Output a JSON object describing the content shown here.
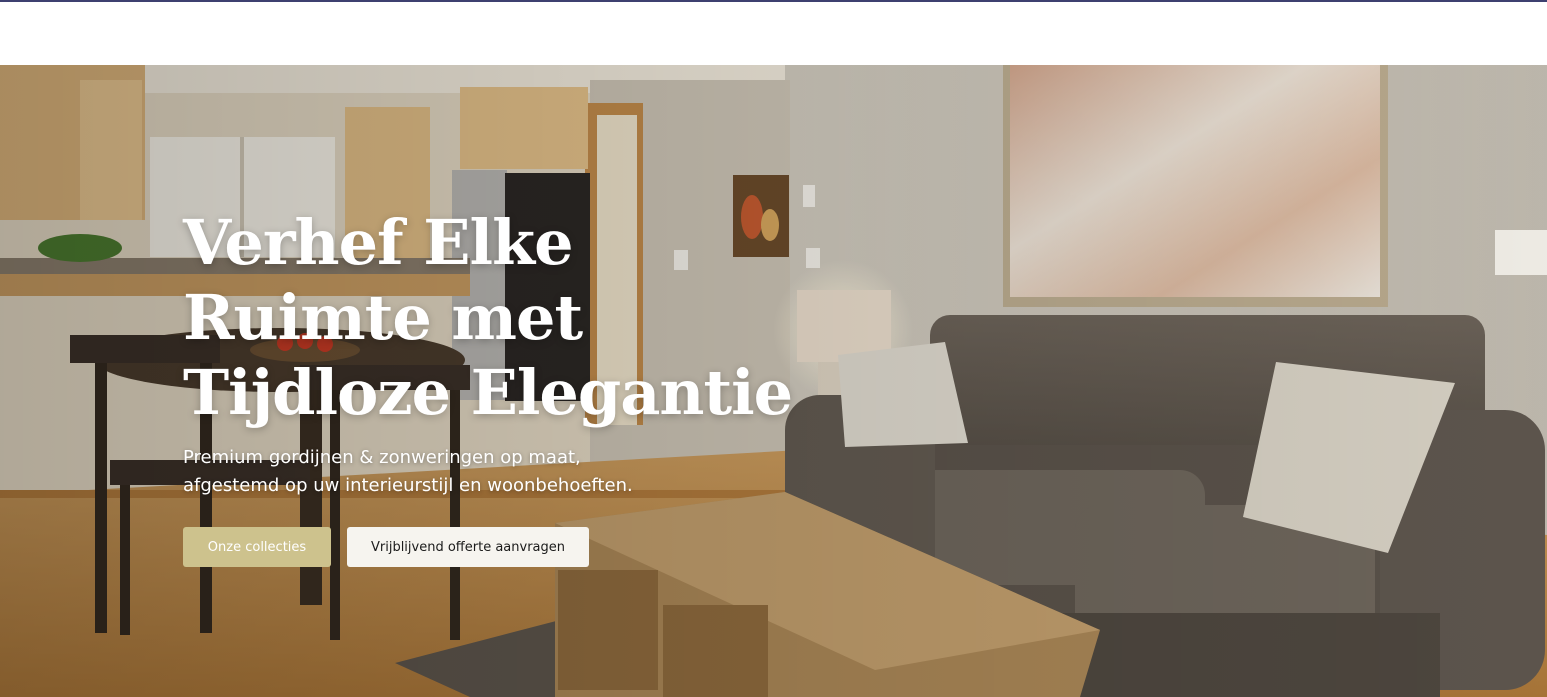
{
  "hero": {
    "title_lines": [
      "Verhef Elke",
      "Ruimte met",
      "Tijdloze Elegantie"
    ],
    "subtitle_lines": [
      "Premium gordijnen & zonweringen op maat,",
      "afgestemd op uw interieurstijl en woonbehoeften."
    ],
    "primary_button": "Onze collecties",
    "secondary_button": "Vrijblijvend offerte aanvragen",
    "background_image": "living-room-kitchen-photo"
  },
  "colors": {
    "top_border": "#3d4070",
    "primary_button_bg": "#cdc28d",
    "secondary_button_bg": "#f6f4ef"
  }
}
